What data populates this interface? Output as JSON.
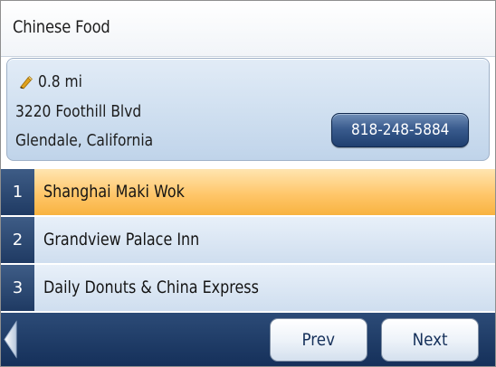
{
  "header": {
    "title": "Chinese Food"
  },
  "details": {
    "distance": "0.8 mi",
    "address_line1": "3220 Foothill Blvd",
    "address_line2": "Glendale, California",
    "phone": "818-248-5884",
    "icon": "pencil-icon"
  },
  "results": [
    {
      "number": "1",
      "name": "Shanghai Maki Wok",
      "selected": true
    },
    {
      "number": "2",
      "name": "Grandview Palace Inn",
      "selected": false
    },
    {
      "number": "3",
      "name": "Daily Donuts & China Express",
      "selected": false
    }
  ],
  "navigation": {
    "back_icon": "back-arrow-icon",
    "prev_label": "Prev",
    "next_label": "Next"
  },
  "colors": {
    "selected_row": "#ffc66a",
    "row_number_bg": "#2b4a74",
    "bottom_bar": "#1f3d68",
    "accent_pencil": "#e0a21c"
  }
}
